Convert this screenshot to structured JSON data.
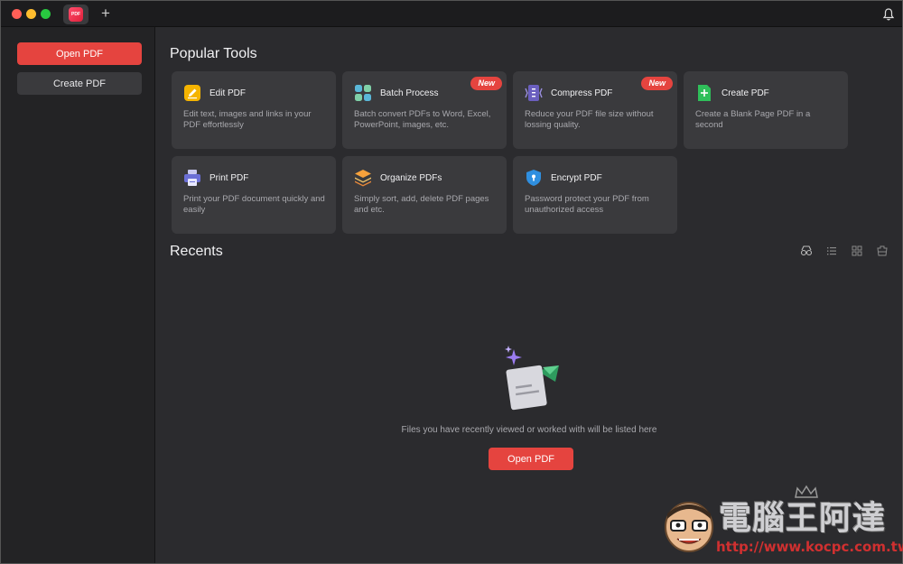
{
  "titlebar": {
    "new_tab_icon": "+",
    "app_logo_text": "PDF"
  },
  "sidebar": {
    "open_pdf": "Open PDF",
    "create_pdf": "Create PDF"
  },
  "popular_tools": {
    "title": "Popular Tools",
    "tools": [
      {
        "title": "Edit PDF",
        "desc": "Edit text, images and links in your PDF effortlessly",
        "badge": "",
        "icon": "edit-icon"
      },
      {
        "title": "Batch Process",
        "desc": "Batch convert PDFs to Word, Excel, PowerPoint, images, etc.",
        "badge": "New",
        "icon": "batch-icon"
      },
      {
        "title": "Compress PDF",
        "desc": "Reduce your PDF file size without lossing quality.",
        "badge": "New",
        "icon": "compress-icon"
      },
      {
        "title": "Create PDF",
        "desc": "Create a Blank Page PDF in a second",
        "badge": "",
        "icon": "create-icon"
      },
      {
        "title": "Print PDF",
        "desc": "Print your PDF document quickly and easily",
        "badge": "",
        "icon": "print-icon"
      },
      {
        "title": "Organize PDFs",
        "desc": "Simply sort, add, delete PDF pages and etc.",
        "badge": "",
        "icon": "organize-icon"
      },
      {
        "title": "Encrypt PDF",
        "desc": "Password protect your PDF from unauthorized access",
        "badge": "",
        "icon": "encrypt-icon"
      }
    ]
  },
  "recents": {
    "title": "Recents",
    "empty_text": "Files you have recently viewed or worked with will be listed here",
    "open_pdf": "Open PDF"
  },
  "watermark": {
    "title": "電腦王阿達",
    "url": "http://www.kocpc.com.tw"
  },
  "colors": {
    "accent": "#e5443f",
    "card": "#3a3a3d",
    "background": "#2b2b2e",
    "sidebar": "#232325"
  }
}
